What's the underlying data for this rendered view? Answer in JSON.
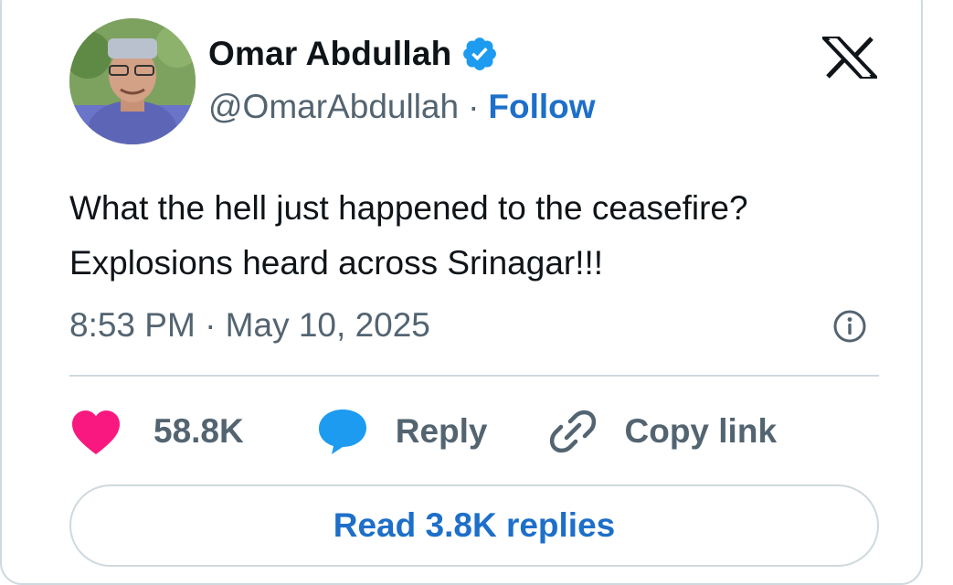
{
  "author": {
    "name": "Omar Abdullah",
    "handle": "@OmarAbdullah",
    "separator": "·",
    "follow_label": "Follow",
    "verified": true
  },
  "brand": {
    "logo_icon": "x-logo-icon"
  },
  "tweet": {
    "lines": [
      "What the hell just happened to the ceasefire?",
      "Explosions heard across Srinagar!!!"
    ],
    "timestamp": "8:53 PM · May 10, 2025"
  },
  "actions": {
    "likes_count": "58.8K",
    "reply_label": "Reply",
    "copy_link_label": "Copy link"
  },
  "read_replies_label": "Read 3.8K replies",
  "colors": {
    "accent": "#1d6fc9",
    "heart": "#f91880",
    "verified": "#1d9bf0",
    "text": "#0f1419",
    "muted": "#536471",
    "border": "#cfd9de"
  }
}
